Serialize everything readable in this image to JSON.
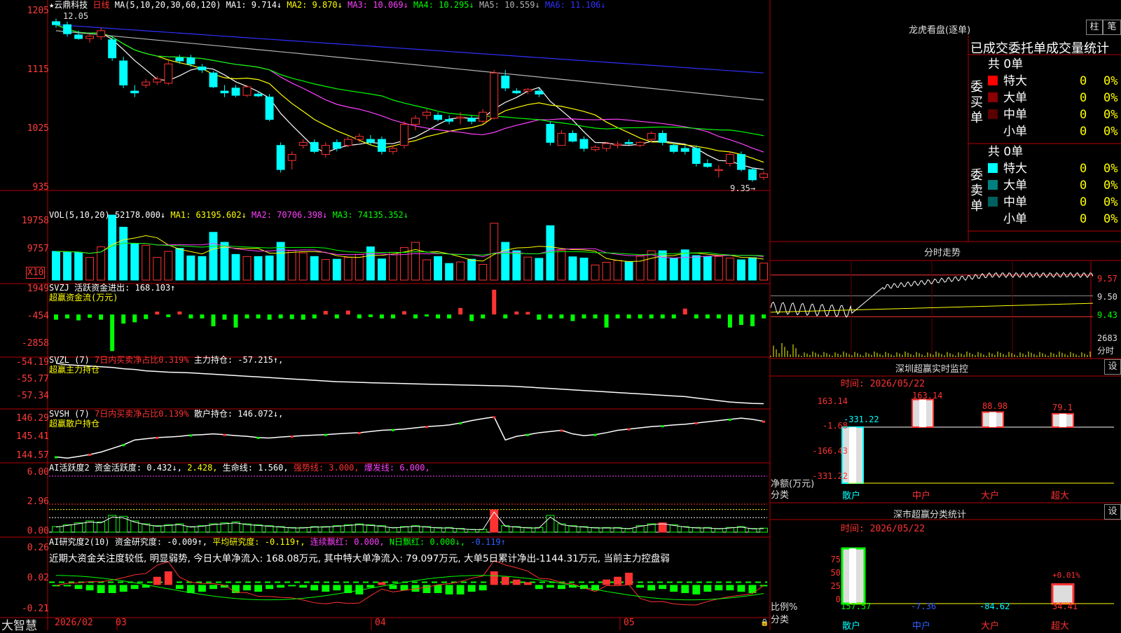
{
  "colors": {
    "up": "#ff3232",
    "down": "#00ffff",
    "bg": "#000000",
    "border": "#b40000",
    "ma1": "#ffffff",
    "ma2": "#ffff00",
    "ma3": "#ff40ff",
    "ma4": "#00ff00",
    "ma5": "#b4b4b4",
    "ma6": "#3030ff",
    "green": "#00ff00",
    "yellow": "#ffff00",
    "magenta": "#ff40ff"
  },
  "main": {
    "stock": "★云鼎科技",
    "period": "日线",
    "ma_head": "MA(5,10,20,30,60,120)",
    "ma1": "MA1: 9.714↓",
    "ma2": "MA2: 9.870↓",
    "ma3": "MA3: 10.069↓",
    "ma4": "MA4: 10.295↓",
    "ma5": "MA5: 10.559↓",
    "ma6": "MA6: 11.106↓",
    "high_mark": "12.05",
    "low_mark": "9.35→",
    "y_ticks": [
      "1205",
      "1115",
      "1025",
      "935"
    ]
  },
  "vol": {
    "title": "VOL(5,10,20)",
    "value": "52178.000↓",
    "ma1": "MA1: 63195.602↓",
    "ma2": "MA2: 70706.398↓",
    "ma3": "MA3: 74135.352↓",
    "y_ticks": [
      "19758",
      "9757"
    ],
    "unit": "X10"
  },
  "svzj": {
    "title": "SVZJ",
    "line1": "活跃资金进出: 168.103↑",
    "line2": "超赢资金流(万元)",
    "y_ticks": [
      "1949",
      "-454",
      "-2858"
    ]
  },
  "svzl": {
    "title": "SVZL (7)",
    "line1": "7日内买卖净占比0.319%",
    "line2": "主力持仓: -57.215↑,",
    "line3": "超赢主力持仓",
    "y_ticks": [
      "-54.19",
      "-55.77",
      "-57.34"
    ]
  },
  "svsh": {
    "title": "SVSH (7)",
    "line1": "7日内买卖净占比0.139%",
    "line2": "散户持仓: 146.072↓,",
    "line3": "超赢散户持仓",
    "y_ticks": [
      "146.29",
      "145.41",
      "144.57"
    ]
  },
  "ai1": {
    "title": "AI活跃度2",
    "t1": "资金活跃度: 0.432↓,",
    "t2": "2.428,",
    "t3": "生命线: 1.560,",
    "t4": "强势线: 3.000,",
    "t5": "爆发线: 6.000,",
    "y_ticks": [
      "6.00",
      "2.96",
      "0.00"
    ]
  },
  "ai2": {
    "title": "AI研究度2(10)",
    "t1": "资金研究度: -0.009↑,",
    "t2": "平均研究度: -0.119↑,",
    "t3": "连续飘红: 0.000,",
    "t4": "N日飘红: 0.000↓,",
    "t5": "-0.119↑",
    "comment": "近期大资金关注度较低, 明显弱势, 今日大单净流入: 168.08万元, 其中特大单净流入: 79.097万元, 大单5日累计净出-1144.31万元, 当前主力控盘弱",
    "y_ticks": [
      "0.26",
      "0.02",
      "-0.21"
    ]
  },
  "bottom": {
    "brand": "大智慧",
    "dates": [
      "2026/02",
      "03",
      "04",
      "05"
    ]
  },
  "dragon": {
    "title": "龙虎看盘(逐单)",
    "btn1": "柱",
    "btn2": "笔",
    "header": "已成交委托单成交量统计",
    "buy_label": "委买单",
    "sell_label": "委卖单",
    "total": "共 0单",
    "rows": [
      {
        "name": "特大",
        "n": "0",
        "pct": "0%"
      },
      {
        "name": "大单",
        "n": "0",
        "pct": "0%"
      },
      {
        "name": "中单",
        "n": "0",
        "pct": "0%"
      },
      {
        "name": "小单",
        "n": "0",
        "pct": "0%"
      }
    ]
  },
  "intraday": {
    "title": "分时走势",
    "prices": [
      "9.57",
      "9.50",
      "9.43"
    ],
    "vol": "2683",
    "vol_unit": "分时"
  },
  "monitor": {
    "title": "深圳超赢实时监控",
    "btn": "设",
    "time": "时间: 2026/05/22",
    "y_ticks": [
      "163.14",
      "-1.68",
      "-166.43",
      "-331.22"
    ],
    "ylabel": "净额(万元)",
    "xlabel": "分类",
    "cats": [
      "散户",
      "中户",
      "大户",
      "超大"
    ],
    "values": [
      "-331.22",
      "163.14",
      "88.98",
      "79.1"
    ]
  },
  "classify": {
    "title": "深市超赢分类统计",
    "btn": "设",
    "time": "时间: 2026/05/22",
    "y_ticks": [
      "75",
      "50",
      "25",
      "0"
    ],
    "ylabel": "比例%",
    "xlabel": "分类",
    "cats": [
      "散户",
      "中户",
      "大户",
      "超大"
    ],
    "values": [
      "157.57",
      "-7.36",
      "-84.62",
      "34.41"
    ],
    "note": "+0.01%"
  },
  "chart_data": [
    {
      "type": "candlestick",
      "name": "日线",
      "ylim": [
        9.25,
        12.15
      ],
      "ohlc": [
        [
          12.0,
          12.05,
          11.9,
          11.95
        ],
        [
          11.95,
          12.0,
          11.75,
          11.8
        ],
        [
          11.78,
          11.85,
          11.7,
          11.72
        ],
        [
          11.72,
          11.8,
          11.65,
          11.76
        ],
        [
          11.75,
          11.9,
          11.7,
          11.85
        ],
        [
          11.7,
          11.75,
          11.35,
          11.4
        ],
        [
          11.35,
          11.42,
          10.9,
          10.95
        ],
        [
          10.85,
          10.95,
          10.75,
          10.82
        ],
        [
          10.95,
          11.05,
          10.9,
          11.0
        ],
        [
          11.0,
          11.1,
          10.95,
          11.05
        ],
        [
          10.98,
          11.35,
          10.95,
          11.3
        ],
        [
          11.4,
          11.45,
          11.3,
          11.35
        ],
        [
          11.4,
          11.45,
          11.25,
          11.3
        ],
        [
          11.25,
          11.3,
          11.15,
          11.2
        ],
        [
          11.15,
          11.18,
          10.9,
          10.92
        ],
        [
          10.85,
          10.95,
          10.75,
          10.82
        ],
        [
          10.9,
          10.95,
          10.75,
          10.78
        ],
        [
          10.78,
          10.95,
          10.75,
          10.92
        ],
        [
          10.8,
          10.85,
          10.75,
          10.77
        ],
        [
          10.75,
          10.8,
          10.35,
          10.38
        ],
        [
          9.95,
          10.0,
          9.5,
          9.55
        ],
        [
          9.7,
          9.85,
          9.55,
          9.8
        ],
        [
          9.95,
          10.05,
          9.9,
          10.0
        ],
        [
          10.0,
          10.05,
          9.82,
          9.85
        ],
        [
          9.8,
          10.0,
          9.75,
          9.95
        ],
        [
          10.0,
          10.05,
          9.85,
          9.9
        ],
        [
          9.95,
          10.1,
          9.92,
          10.05
        ],
        [
          10.05,
          10.15,
          10.0,
          10.1
        ],
        [
          10.05,
          10.12,
          9.95,
          10.0
        ],
        [
          10.05,
          10.1,
          9.8,
          9.85
        ],
        [
          9.85,
          9.95,
          9.8,
          9.9
        ],
        [
          9.95,
          10.35,
          9.9,
          10.3
        ],
        [
          10.3,
          10.45,
          10.2,
          10.4
        ],
        [
          10.45,
          10.55,
          10.38,
          10.5
        ],
        [
          10.45,
          10.5,
          10.35,
          10.38
        ],
        [
          10.38,
          10.45,
          10.3,
          10.35
        ],
        [
          10.4,
          10.5,
          10.3,
          10.42
        ],
        [
          10.4,
          10.45,
          10.3,
          10.35
        ],
        [
          10.35,
          10.55,
          10.3,
          10.5
        ],
        [
          10.4,
          11.2,
          10.38,
          11.15
        ],
        [
          11.1,
          11.2,
          10.85,
          10.9
        ],
        [
          10.85,
          10.9,
          10.8,
          10.82
        ],
        [
          10.85,
          10.9,
          10.8,
          10.88
        ],
        [
          10.85,
          10.9,
          10.75,
          10.8
        ],
        [
          10.3,
          10.35,
          9.95,
          10.0
        ],
        [
          9.95,
          10.2,
          9.95,
          10.15
        ],
        [
          10.15,
          10.2,
          10.0,
          10.02
        ],
        [
          10.05,
          10.1,
          9.85,
          9.9
        ],
        [
          9.88,
          9.95,
          9.85,
          9.92
        ],
        [
          9.9,
          10.0,
          9.85,
          9.98
        ],
        [
          9.95,
          10.02,
          9.9,
          9.97
        ],
        [
          10.0,
          10.05,
          9.95,
          9.98
        ],
        [
          9.95,
          10.02,
          9.92,
          10.0
        ],
        [
          10.05,
          10.18,
          10.0,
          10.15
        ],
        [
          10.15,
          10.2,
          9.95,
          10.0
        ],
        [
          9.95,
          10.0,
          9.82,
          9.85
        ],
        [
          9.9,
          9.95,
          9.8,
          9.85
        ],
        [
          9.9,
          9.95,
          9.6,
          9.65
        ],
        [
          9.65,
          9.72,
          9.58,
          9.6
        ],
        [
          9.55,
          9.62,
          9.42,
          9.55
        ],
        [
          9.65,
          9.85,
          9.6,
          9.8
        ],
        [
          9.8,
          9.85,
          9.52,
          9.55
        ],
        [
          9.55,
          9.58,
          9.35,
          9.38
        ],
        [
          9.42,
          9.52,
          9.38,
          9.48
        ]
      ]
    },
    {
      "type": "bar",
      "name": "VOL",
      "ylim": [
        0,
        22000
      ],
      "values": [
        9500,
        9300,
        9100,
        7500,
        11000,
        21500,
        17500,
        12000,
        11500,
        7500,
        9500,
        10500,
        8000,
        7800,
        15800,
        12500,
        8500,
        7800,
        7800,
        8000,
        12500,
        9800,
        9000,
        7800,
        6800,
        6900,
        7500,
        8500,
        11000,
        7000,
        9200,
        10800,
        12500,
        6700,
        7800,
        5500,
        6000,
        6900,
        5200,
        18800,
        12500,
        9700,
        7600,
        7200,
        18000,
        9800,
        7700,
        7300,
        5000,
        5900,
        6500,
        6000,
        7900,
        9700,
        9700,
        7200,
        10000,
        8100,
        7800,
        7800,
        7300,
        6700,
        7400,
        5600
      ]
    },
    {
      "type": "bar",
      "name": "SVZJ",
      "ylim": [
        -3000,
        2100
      ],
      "values": [
        -400,
        -300,
        -450,
        -250,
        -400,
        -2800,
        -700,
        -600,
        -350,
        220,
        -200,
        230,
        -300,
        -300,
        -900,
        -400,
        -1000,
        -300,
        -300,
        -400,
        -300,
        -350,
        -400,
        -300,
        270,
        -300,
        300,
        -300,
        -200,
        -300,
        -300,
        250,
        -300,
        -150,
        -300,
        -300,
        500,
        -500,
        -300,
        1900,
        -300,
        230,
        200,
        -400,
        -300,
        -300,
        -500,
        -300,
        -300,
        -1000,
        -300,
        -300,
        -300,
        -300,
        -300,
        -300,
        450,
        -300,
        -300,
        -300,
        -1000,
        -800,
        -900,
        -300
      ]
    },
    {
      "type": "line",
      "name": "SVZL",
      "ylim": [
        -57.4,
        -54.1
      ],
      "values": [
        -54.25,
        -54.35,
        -54.4,
        -54.45,
        -54.5,
        -54.55,
        -54.65,
        -54.7,
        -54.8,
        -54.85,
        -54.9,
        -54.92,
        -54.95,
        -55.0,
        -55.05,
        -55.1,
        -55.15,
        -55.2,
        -55.25,
        -55.3,
        -55.35,
        -55.4,
        -55.45,
        -55.5,
        -55.55,
        -55.6,
        -55.62,
        -55.65,
        -55.68,
        -55.7,
        -55.72,
        -55.74,
        -55.76,
        -55.78,
        -55.8,
        -55.82,
        -55.84,
        -55.86,
        -55.88,
        -55.9,
        -55.92,
        -55.95,
        -56.0,
        -56.05,
        -56.1,
        -56.15,
        -56.2,
        -56.25,
        -56.3,
        -56.35,
        -56.4,
        -56.45,
        -56.5,
        -56.55,
        -56.6,
        -56.65,
        -56.7,
        -56.8,
        -56.9,
        -57.0,
        -57.1,
        -57.15,
        -57.2,
        -57.22
      ]
    },
    {
      "type": "line",
      "name": "SVSH",
      "ylim": [
        144.5,
        146.35
      ],
      "values": [
        144.6,
        144.55,
        144.62,
        144.7,
        144.8,
        144.95,
        145.1,
        145.3,
        145.35,
        145.4,
        145.42,
        145.45,
        145.5,
        145.52,
        145.55,
        145.52,
        145.48,
        145.45,
        145.4,
        145.38,
        145.42,
        145.45,
        145.48,
        145.5,
        145.52,
        145.55,
        145.58,
        145.6,
        145.65,
        145.7,
        145.72,
        145.75,
        145.8,
        145.85,
        145.88,
        145.92,
        146.0,
        146.1,
        146.18,
        146.25,
        145.3,
        145.45,
        145.52,
        145.6,
        145.65,
        145.7,
        145.55,
        145.48,
        145.52,
        145.6,
        145.7,
        145.75,
        145.8,
        145.85,
        145.88,
        145.92,
        145.95,
        146.0,
        146.05,
        146.1,
        146.15,
        146.2,
        146.15,
        146.07
      ]
    },
    {
      "type": "bar",
      "name": "AI活跃度2",
      "ylim": [
        0,
        6.3
      ],
      "values": [
        0.6,
        0.8,
        1.0,
        1.2,
        1.1,
        1.8,
        1.7,
        1.2,
        0.9,
        0.7,
        0.8,
        0.9,
        0.6,
        0.7,
        0.9,
        1.0,
        1.1,
        0.9,
        0.8,
        0.7,
        0.6,
        0.5,
        0.5,
        0.6,
        0.6,
        0.7,
        0.8,
        0.9,
        0.8,
        0.7,
        0.5,
        0.6,
        0.7,
        0.6,
        0.5,
        0.5,
        0.4,
        0.3,
        0.3,
        2.4,
        0.7,
        0.6,
        0.5,
        0.5,
        1.8,
        0.9,
        0.7,
        0.6,
        0.5,
        0.5,
        0.5,
        0.4,
        0.7,
        0.9,
        1.0,
        0.8,
        0.6,
        0.5,
        0.5,
        0.4,
        0.5,
        0.6,
        0.4,
        0.43
      ]
    },
    {
      "type": "bar",
      "name": "AI研究度2",
      "ylim": [
        -0.22,
        0.27
      ],
      "values": [
        -0.005,
        -0.01,
        -0.03,
        -0.04,
        -0.06,
        -0.06,
        -0.05,
        -0.03,
        -0.02,
        0.06,
        0.1,
        -0.03,
        -0.06,
        -0.05,
        -0.03,
        -0.02,
        -0.06,
        -0.04,
        -0.05,
        -0.03,
        -0.02,
        -0.01,
        -0.02,
        -0.04,
        -0.05,
        -0.04,
        -0.06,
        -0.07,
        -0.02,
        0.02,
        -0.03,
        -0.04,
        -0.05,
        -0.06,
        -0.06,
        -0.07,
        -0.07,
        -0.05,
        -0.04,
        0.1,
        0.06,
        0.04,
        0.02,
        -0.03,
        -0.02,
        -0.03,
        -0.02,
        -0.03,
        -0.04,
        0.04,
        0.06,
        0.09,
        -0.02,
        -0.04,
        -0.03,
        -0.05,
        -0.06,
        -0.07,
        -0.05,
        -0.04,
        -0.04,
        -0.05,
        -0.06,
        -0.009
      ]
    }
  ]
}
